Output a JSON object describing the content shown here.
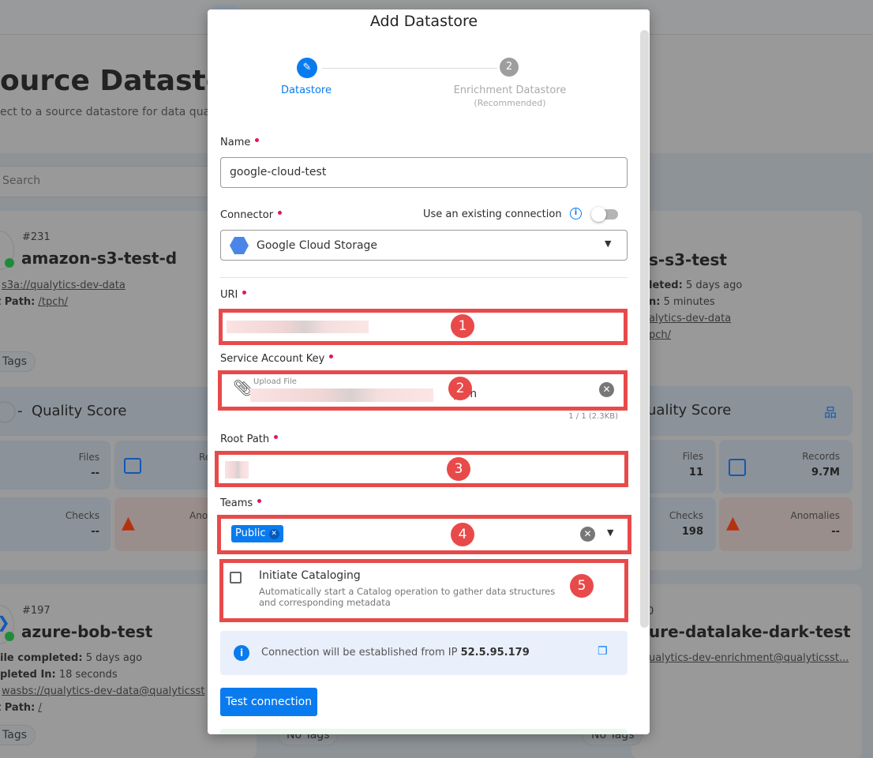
{
  "background": {
    "page_title": "ource Datastore",
    "page_subtitle": "ect to a source datastore for data quality a",
    "search_placeholder": "Search",
    "cards": [
      {
        "id": "#231",
        "name": "amazon-s3-test-d",
        "uri_label": "s3a://qualytics-dev-data",
        "root_path_label": "t Path:",
        "root_path": "/tpch/",
        "tags": "Tags",
        "quality_score": "Quality Score",
        "quality_dash": "-",
        "files_label": "Files",
        "files_value": "--",
        "records_label": "Re",
        "checks_label": "Checks",
        "checks_value": "--",
        "anomalies_label": "Ano"
      },
      {
        "name": "s-s3-test",
        "profile_label": "leted:",
        "profile_value": "5 days ago",
        "duration_label": "n:",
        "duration_value": "5 minutes",
        "uri": "alytics-dev-data",
        "root_path": "pch/",
        "quality_score": "uality Score",
        "files_label": "Files",
        "files_value": "11",
        "records_label": "Records",
        "records_value": "9.7M",
        "checks_label": "Checks",
        "checks_value": "198",
        "anomalies_label": "Anomalies",
        "anomalies_value": "--"
      },
      {
        "id": "#197",
        "name": "azure-bob-test",
        "profile_label": "ile completed:",
        "profile_value": "5 days ago",
        "duration_label": "pleted In:",
        "duration_value": "18 seconds",
        "uri": "wasbs://qualytics-dev-data@qualyticsst",
        "root_path_label": "t Path:",
        "root_path": "/",
        "tags": "Tags",
        "bottom_tag": "No Tags"
      },
      {
        "id": "0",
        "name": "ure-datalake-dark-test",
        "uri": "ualytics-dev-enrichment@qualyticsst...",
        "bottom_tag": "No Tags"
      }
    ]
  },
  "modal": {
    "title": "Add Datastore",
    "steps": [
      {
        "label": "Datastore",
        "icon": "pencil-icon",
        "active": true
      },
      {
        "number": "2",
        "label": "Enrichment Datastore",
        "sublabel": "(Recommended)",
        "active": false
      }
    ],
    "name": {
      "label": "Name",
      "value": "google-cloud-test"
    },
    "connector": {
      "label": "Connector",
      "existing_label": "Use an existing connection",
      "existing_enabled": false,
      "value": "Google Cloud Storage"
    },
    "uri": {
      "label": "URI"
    },
    "service_account_key": {
      "label": "Service Account Key",
      "upload_label": "Upload File",
      "file_suffix": ".json",
      "count": "1 / 1 (2.3KB)"
    },
    "root_path": {
      "label": "Root Path"
    },
    "teams": {
      "label": "Teams",
      "chips": [
        "Public"
      ]
    },
    "cataloging": {
      "label": "Initiate Cataloging",
      "description": "Automatically start a Catalog operation to gather data structures and corresponding metadata",
      "checked": false
    },
    "ip_info": {
      "text": "Connection will be established from IP",
      "ip": "52.5.95.179"
    },
    "test_button": "Test connection",
    "annotations": [
      "1",
      "2",
      "3",
      "4",
      "5"
    ]
  },
  "colors": {
    "accent": "#0a7bef",
    "annotation": "#e84a4a",
    "required": "#e3165b",
    "info_bg": "#e9f0fb"
  }
}
